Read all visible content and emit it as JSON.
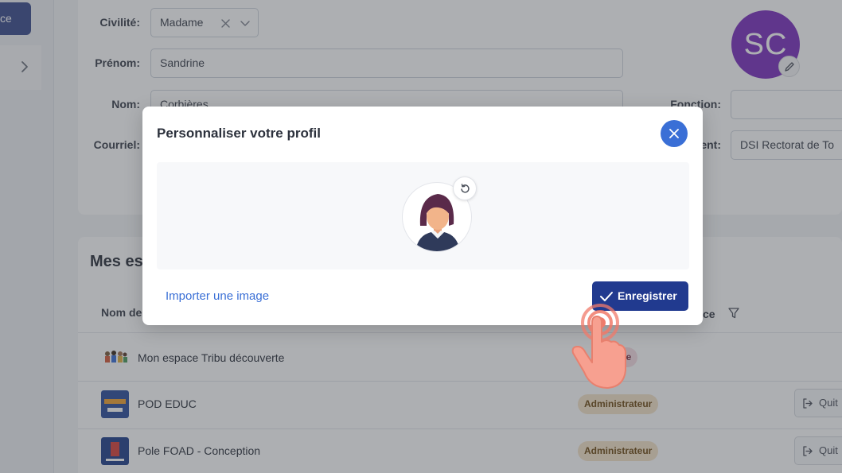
{
  "sidebar": {
    "button_label": "ce",
    "chevron_icon": "chevron-right-icon"
  },
  "profile_form": {
    "civility_label": "Civilité:",
    "civility_value": "Madame",
    "first_name_label": "Prénom:",
    "first_name_value": "Sandrine",
    "last_name_label": "Nom:",
    "last_name_value": "Corbières",
    "email_label": "Courriel:",
    "function_label": "Fonction:",
    "establishment_label_fragment": "ent:",
    "establishment_value": "DSI Rectorat de To",
    "avatar_initials": "SC",
    "avatar_color": "#7b2fbe"
  },
  "spaces": {
    "title_fragment": "Mes es",
    "column_name_fragment": "Nom de",
    "column_role_fragment": "ce",
    "rows": [
      {
        "name": "Mon espace Tribu découverte",
        "role": "Stagiaire",
        "role_visible": "taire",
        "quit": ""
      },
      {
        "name": "POD EDUC",
        "role": "Administrateur",
        "quit": "Quit"
      },
      {
        "name": "Pole FOAD - Conception",
        "role": "Administrateur",
        "quit": "Quit"
      }
    ]
  },
  "modal": {
    "title": "Personnaliser votre profil",
    "import_label": "Importer une image",
    "save_label": "Enregistrer",
    "close_icon": "close-icon",
    "reset_icon": "rotate-ccw-icon"
  },
  "colors": {
    "primary": "#213a8f",
    "accent_blue": "#3a6fd6",
    "badge_admin_bg": "#f5e3c9",
    "tap_hint": "#f07a6a"
  }
}
